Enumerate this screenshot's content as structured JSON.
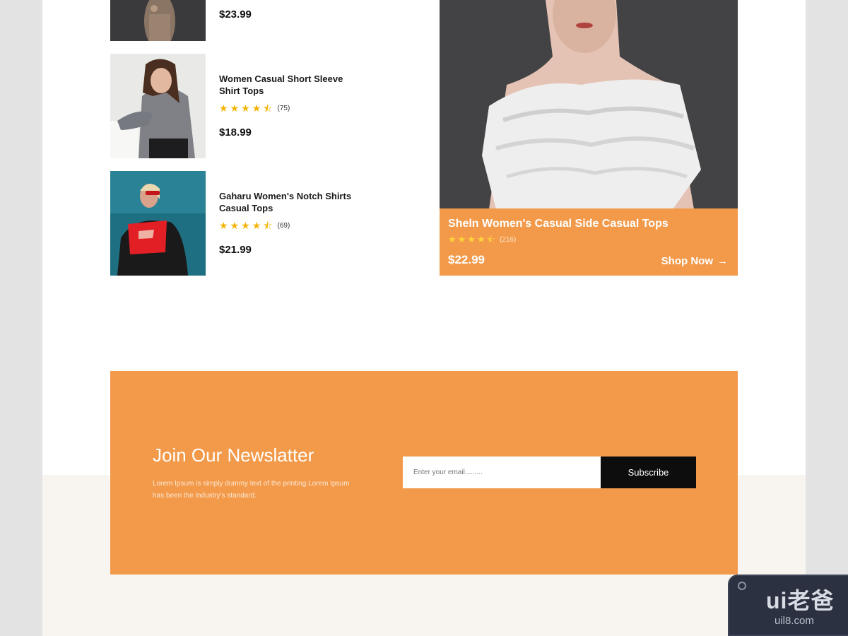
{
  "products": [
    {
      "price": "$23.99"
    },
    {
      "title": "Women Casual Short Sleeve Shirt Tops",
      "stars": 4.5,
      "count": "(75)",
      "price": "$18.99"
    },
    {
      "title": "Gaharu Women's Notch Shirts Casual Tops",
      "stars": 4.5,
      "count": "(69)",
      "price": "$21.99"
    }
  ],
  "featured": {
    "title": "Sheln Women's Casual Side Casual Tops",
    "stars": 4.5,
    "count": "(216)",
    "price": "$22.99",
    "cta": "Shop Now"
  },
  "newsletter": {
    "title": "Join Our Newslatter",
    "description": "Lorem Ipsum is simply dummy text of the printing.Lorem Ipsum has been the industry's standard.",
    "email_placeholder": "Enter your email.........",
    "button": "Subscribe"
  },
  "watermark": {
    "logo": "ui老爸",
    "url": "uil8.com"
  },
  "colors": {
    "accent": "#f29a4a",
    "star": "#f4b300",
    "button": "#0d0d0d",
    "footer_bg": "#f8f5f0"
  },
  "icons": {
    "star": "star-icon",
    "half_star": "star-half-icon",
    "arrow": "arrow-right-icon"
  }
}
